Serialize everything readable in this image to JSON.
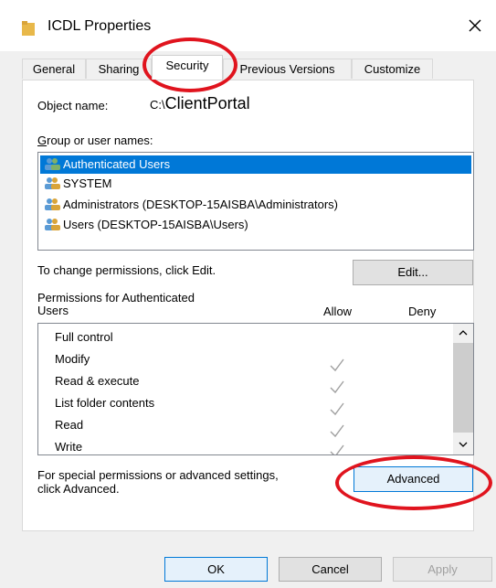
{
  "window": {
    "title": "ICDL Properties"
  },
  "tabs": [
    {
      "label": "General"
    },
    {
      "label": "Sharing"
    },
    {
      "label": "Security"
    },
    {
      "label": "Previous Versions"
    },
    {
      "label": "Customize"
    }
  ],
  "security": {
    "object_name_label": "Object name:",
    "object_name_prefix": "C:\\",
    "object_name_value": "ClientPortal",
    "group_label": "Group or user names:",
    "users": [
      {
        "name": "Authenticated Users",
        "selected": true
      },
      {
        "name": "SYSTEM",
        "selected": false
      },
      {
        "name": "Administrators (DESKTOP-15AISBA\\Administrators)",
        "selected": false
      },
      {
        "name": "Users (DESKTOP-15AISBA\\Users)",
        "selected": false
      }
    ],
    "change_hint": "To change permissions, click Edit.",
    "edit_button": "Edit...",
    "permissions_label_line1": "Permissions for Authenticated",
    "permissions_label_line2": "Users",
    "allow_header": "Allow",
    "deny_header": "Deny",
    "permissions": [
      {
        "name": "Full control",
        "allow": false
      },
      {
        "name": "Modify",
        "allow": true
      },
      {
        "name": "Read & execute",
        "allow": true
      },
      {
        "name": "List folder contents",
        "allow": true
      },
      {
        "name": "Read",
        "allow": true
      },
      {
        "name": "Write",
        "allow": true
      }
    ],
    "advanced_hint_line1": "For special permissions or advanced settings,",
    "advanced_hint_line2": "click Advanced.",
    "advanced_button": "Advanced"
  },
  "footer": {
    "ok_button": "OK",
    "cancel_button": "Cancel",
    "apply_button": "Apply"
  },
  "colors": {
    "selection": "#0078d7",
    "annotation": "#e0141e",
    "check": "#a0a0a0"
  }
}
